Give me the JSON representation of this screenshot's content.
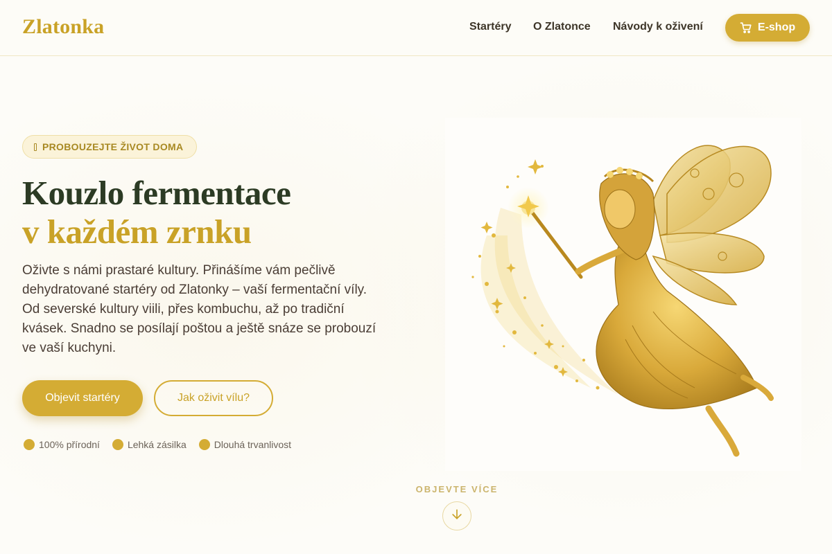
{
  "header": {
    "logo": "Zlatonka",
    "nav": [
      {
        "label": "Startéry"
      },
      {
        "label": "O Zlatonce"
      },
      {
        "label": "Návody k oživení"
      }
    ],
    "eshop_label": "E-shop",
    "eshop_icon": "cart-icon"
  },
  "hero": {
    "badge": "PROBOUZEJTE ŽIVOT DOMA",
    "badge_icon": "jar-icon",
    "title_line1": "Kouzlo fermentace",
    "title_line2": "v každém zrnku",
    "description": "Oživte s námi prastaré kultury. Přinášíme vám pečlivě dehydratované startéry od Zlatonky – vaší fermentační víly. Od severské kultury viili, přes kombuchu, až po tradiční kvásek. Snadno se posílají poštou a ještě snáze se probouzí ve vaší kuchyni.",
    "primary_button": "Objevit startéry",
    "secondary_button": "Jak oživit vílu?",
    "features": [
      {
        "label": "100% přírodní"
      },
      {
        "label": "Lehká zásilka"
      },
      {
        "label": "Dlouhá trvanlivost"
      }
    ]
  },
  "illustration": {
    "subject": "golden-fairy-illustration"
  },
  "scroll": {
    "label": "OBJEVTE VÍCE",
    "icon": "arrow-down-icon"
  },
  "colors": {
    "accent": "#d4ac34",
    "heading_dark": "#2c3b24",
    "text": "#4a3d35",
    "background": "#fdfcf8"
  }
}
